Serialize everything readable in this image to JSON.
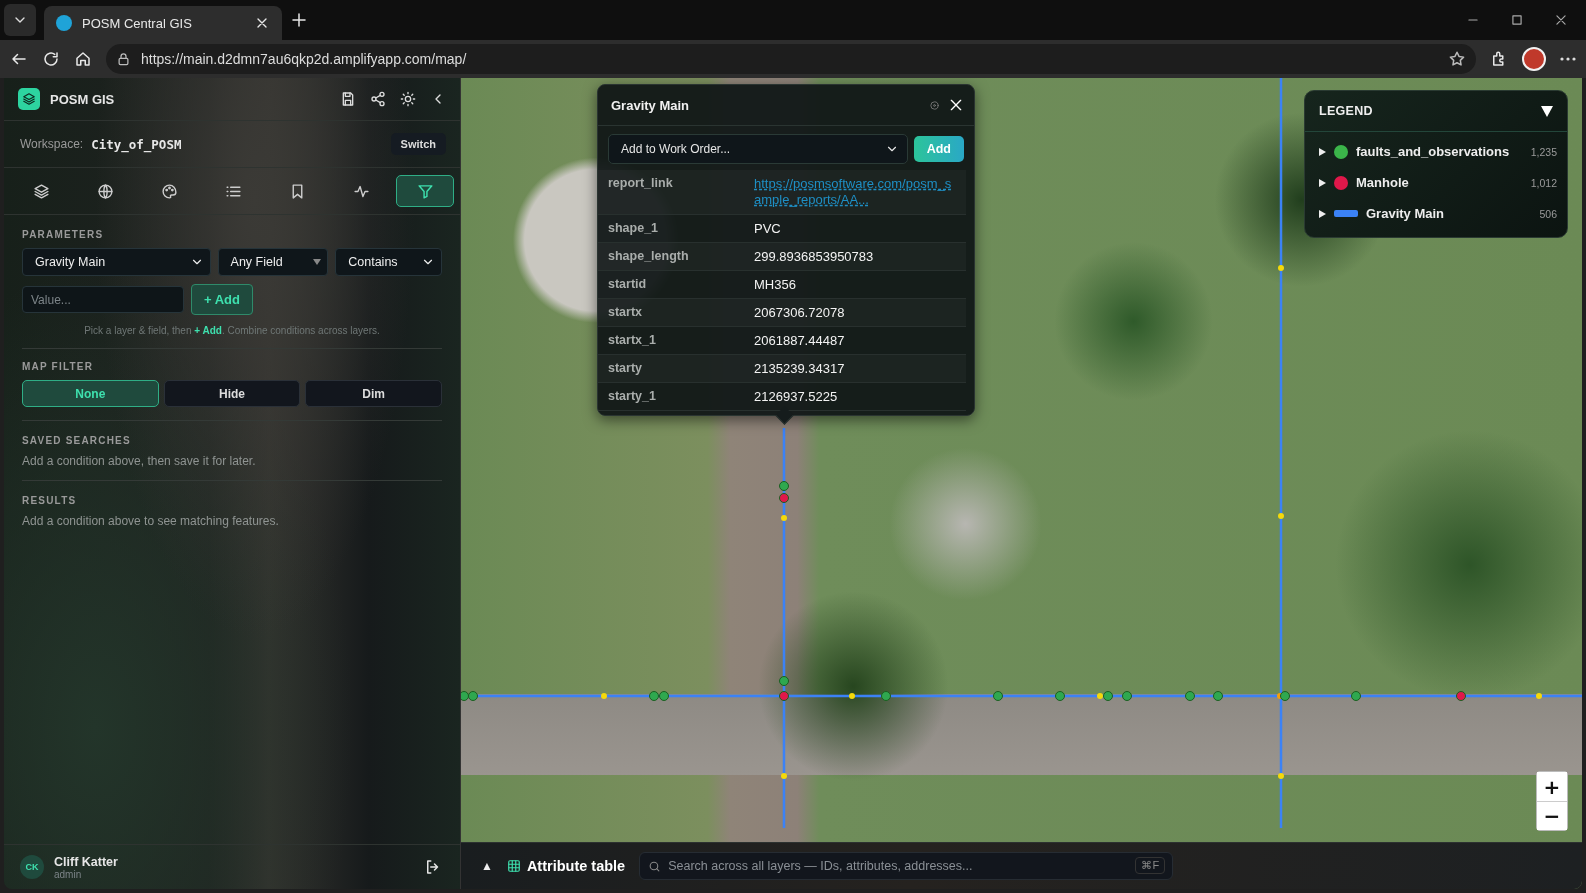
{
  "browser": {
    "tab_title": "POSM Central GIS",
    "url": "https://main.d2dmn7au6qkp2d.amplifyapp.com/map/"
  },
  "sidebar": {
    "app_name": "POSM GIS",
    "workspace_label": "Workspace:",
    "workspace": "City_of_POSM",
    "switch_button": "Switch",
    "tool_tabs": [
      {
        "selected": false
      },
      {
        "selected": false
      },
      {
        "selected": false
      },
      {
        "selected": false
      },
      {
        "selected": false
      },
      {
        "selected": false
      },
      {
        "selected": true
      }
    ],
    "parameters": {
      "heading": "PARAMETERS",
      "layer": "Gravity Main",
      "field": "Any Field",
      "operator": "Contains",
      "value_placeholder": "Value...",
      "add_button": "+ Add",
      "hint": "Pick a layer & field, then **+ Add**. Combine conditions across layers."
    },
    "map_filter": {
      "heading": "MAP FILTER",
      "options": [
        {
          "label": "None",
          "selected": true
        },
        {
          "label": "Hide",
          "selected": false
        },
        {
          "label": "Dim",
          "selected": false
        }
      ]
    },
    "saved_searches": {
      "heading": "SAVED SEARCHES",
      "text": "Add a condition above, then save it for later."
    },
    "results": {
      "heading": "RESULTS",
      "text": "Add a condition above to see matching features."
    },
    "user": {
      "initials": "CK",
      "name": "Cliff Katter",
      "role": "admin"
    }
  },
  "popup": {
    "title": "Gravity Main",
    "work_order_select": "Add to Work Order...",
    "add_button": "Add",
    "attributes": [
      {
        "key": "report_link",
        "value": "https://posmsoftware.com/posm_sample_reports/AA...",
        "kind": "link"
      },
      {
        "key": "shape_1",
        "value": "PVC",
        "kind": "text"
      },
      {
        "key": "shape_length",
        "value": "299.8936853950783",
        "kind": "text"
      },
      {
        "key": "startid",
        "value": "MH356",
        "kind": "text"
      },
      {
        "key": "startx",
        "value": "2067306.72078",
        "kind": "text"
      },
      {
        "key": "startx_1",
        "value": "2061887.44487",
        "kind": "text"
      },
      {
        "key": "starty",
        "value": "2135239.34317",
        "kind": "text"
      },
      {
        "key": "starty_1",
        "value": "2126937.5225",
        "kind": "text"
      }
    ]
  },
  "legend": {
    "title": "LEGEND",
    "items": [
      {
        "name": "faults_and_observations",
        "count": "1,235",
        "color": "#3bb54a",
        "kind": "point"
      },
      {
        "name": "Manhole",
        "count": "1,012",
        "color": "#e0184a",
        "kind": "point"
      },
      {
        "name": "Gravity Main",
        "count": "506",
        "color": "#3b82f6",
        "kind": "line"
      }
    ]
  },
  "zoom_controls": {
    "zoom_in": "+",
    "zoom_out": "−"
  },
  "bottom_bar": {
    "toggle": "▲",
    "attribute_table": "Attribute table",
    "search_placeholder": "Search across all layers — IDs, attributes, addresses...",
    "shortcut": "⌘F"
  }
}
